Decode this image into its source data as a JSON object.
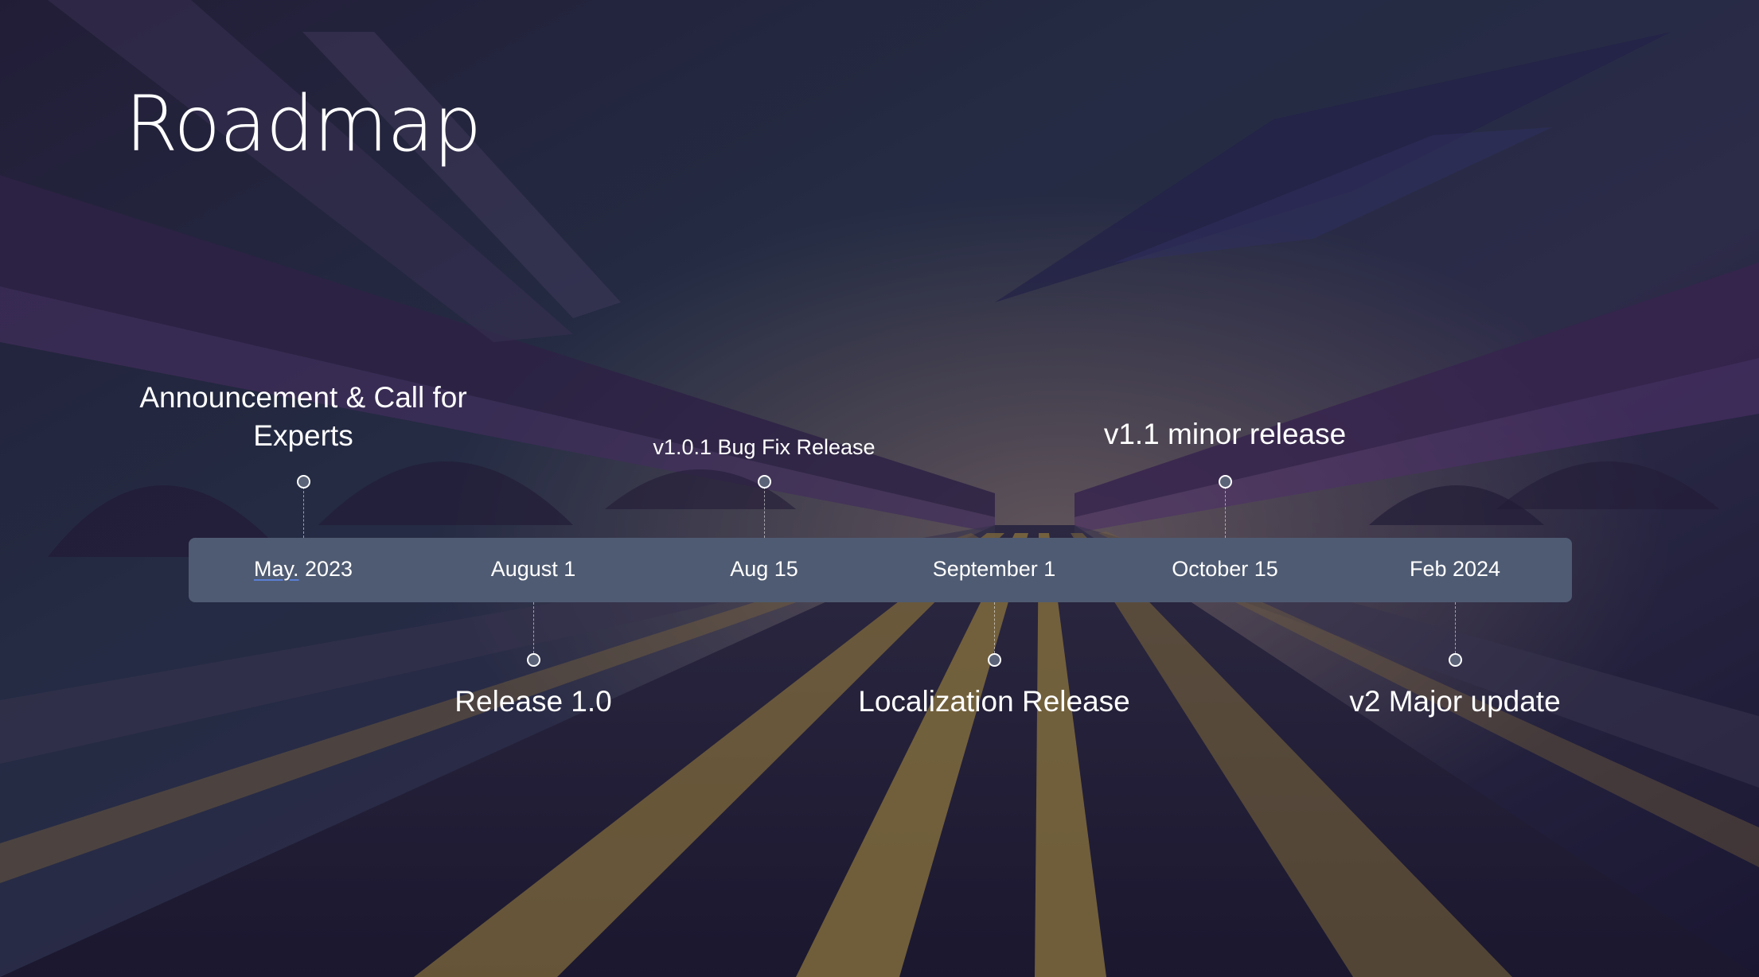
{
  "slide": {
    "title": "Roadmap"
  },
  "timeline": {
    "dates": [
      {
        "prefix": "May.",
        "rest": " 2023"
      },
      {
        "text": "August 1"
      },
      {
        "text": "Aug 15"
      },
      {
        "text": "September 1"
      },
      {
        "text": "October 15"
      },
      {
        "text": "Feb 2024"
      }
    ],
    "milestones_above": [
      {
        "line1": "Announcement & Call for",
        "line2": "Experts"
      },
      {
        "line1": "v1.0.1 Bug Fix Release"
      },
      {
        "line1": "v1.1 minor release"
      }
    ],
    "milestones_below": [
      {
        "line1": "Release 1.0"
      },
      {
        "line1": "Localization Release"
      },
      {
        "line1": "v2 Major update"
      }
    ]
  },
  "colors": {
    "bar": "#4f5b72",
    "text": "#ffffff",
    "underline": "#5b7fd6"
  }
}
